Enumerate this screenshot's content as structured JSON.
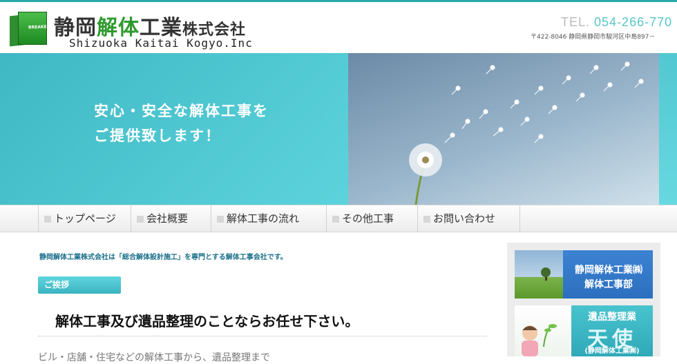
{
  "header": {
    "logo_text": "BREAKER",
    "company_jp_part1": "静岡",
    "company_jp_part2": "解体",
    "company_jp_part3": "工業",
    "company_jp_suffix": "株式会社",
    "company_en": "Shizuoka Kaitai Kogyo.Inc",
    "tel_label": "TEL.",
    "tel_number": "054-266-770",
    "address": "〒422-8046 静岡県静岡市駿河区中島897－"
  },
  "hero": {
    "line1": "安心・安全な解体工事を",
    "line2": "ご提供致します！"
  },
  "nav": {
    "items": [
      {
        "label": "トップページ"
      },
      {
        "label": "会社概要"
      },
      {
        "label": "解体工事の流れ"
      },
      {
        "label": "その他工事"
      },
      {
        "label": "お問い合わせ"
      }
    ]
  },
  "main": {
    "intro": "静岡解体工業株式会社は「総合解体設計施工」を専門とする解体工事会社です。",
    "greeting_badge": "ご挨拶",
    "title": "解体工事及び遺品整理のことならお任せ下さい。",
    "body_text": "ビル・店舗・住宅などの解体工事から、遺品整理まで"
  },
  "sidebar": {
    "banner1_line1": "静岡解体工業㈱",
    "banner1_line2": "解体工事部",
    "banner2_line1": "遺品整理業",
    "banner2_line2": "天使",
    "banner2_line3": "(静岡解体工業㈱)"
  },
  "colors": {
    "accent_teal": "#3bb3c1",
    "brand_green": "#2e9a2e",
    "banner_blue": "#2c6fbe"
  }
}
